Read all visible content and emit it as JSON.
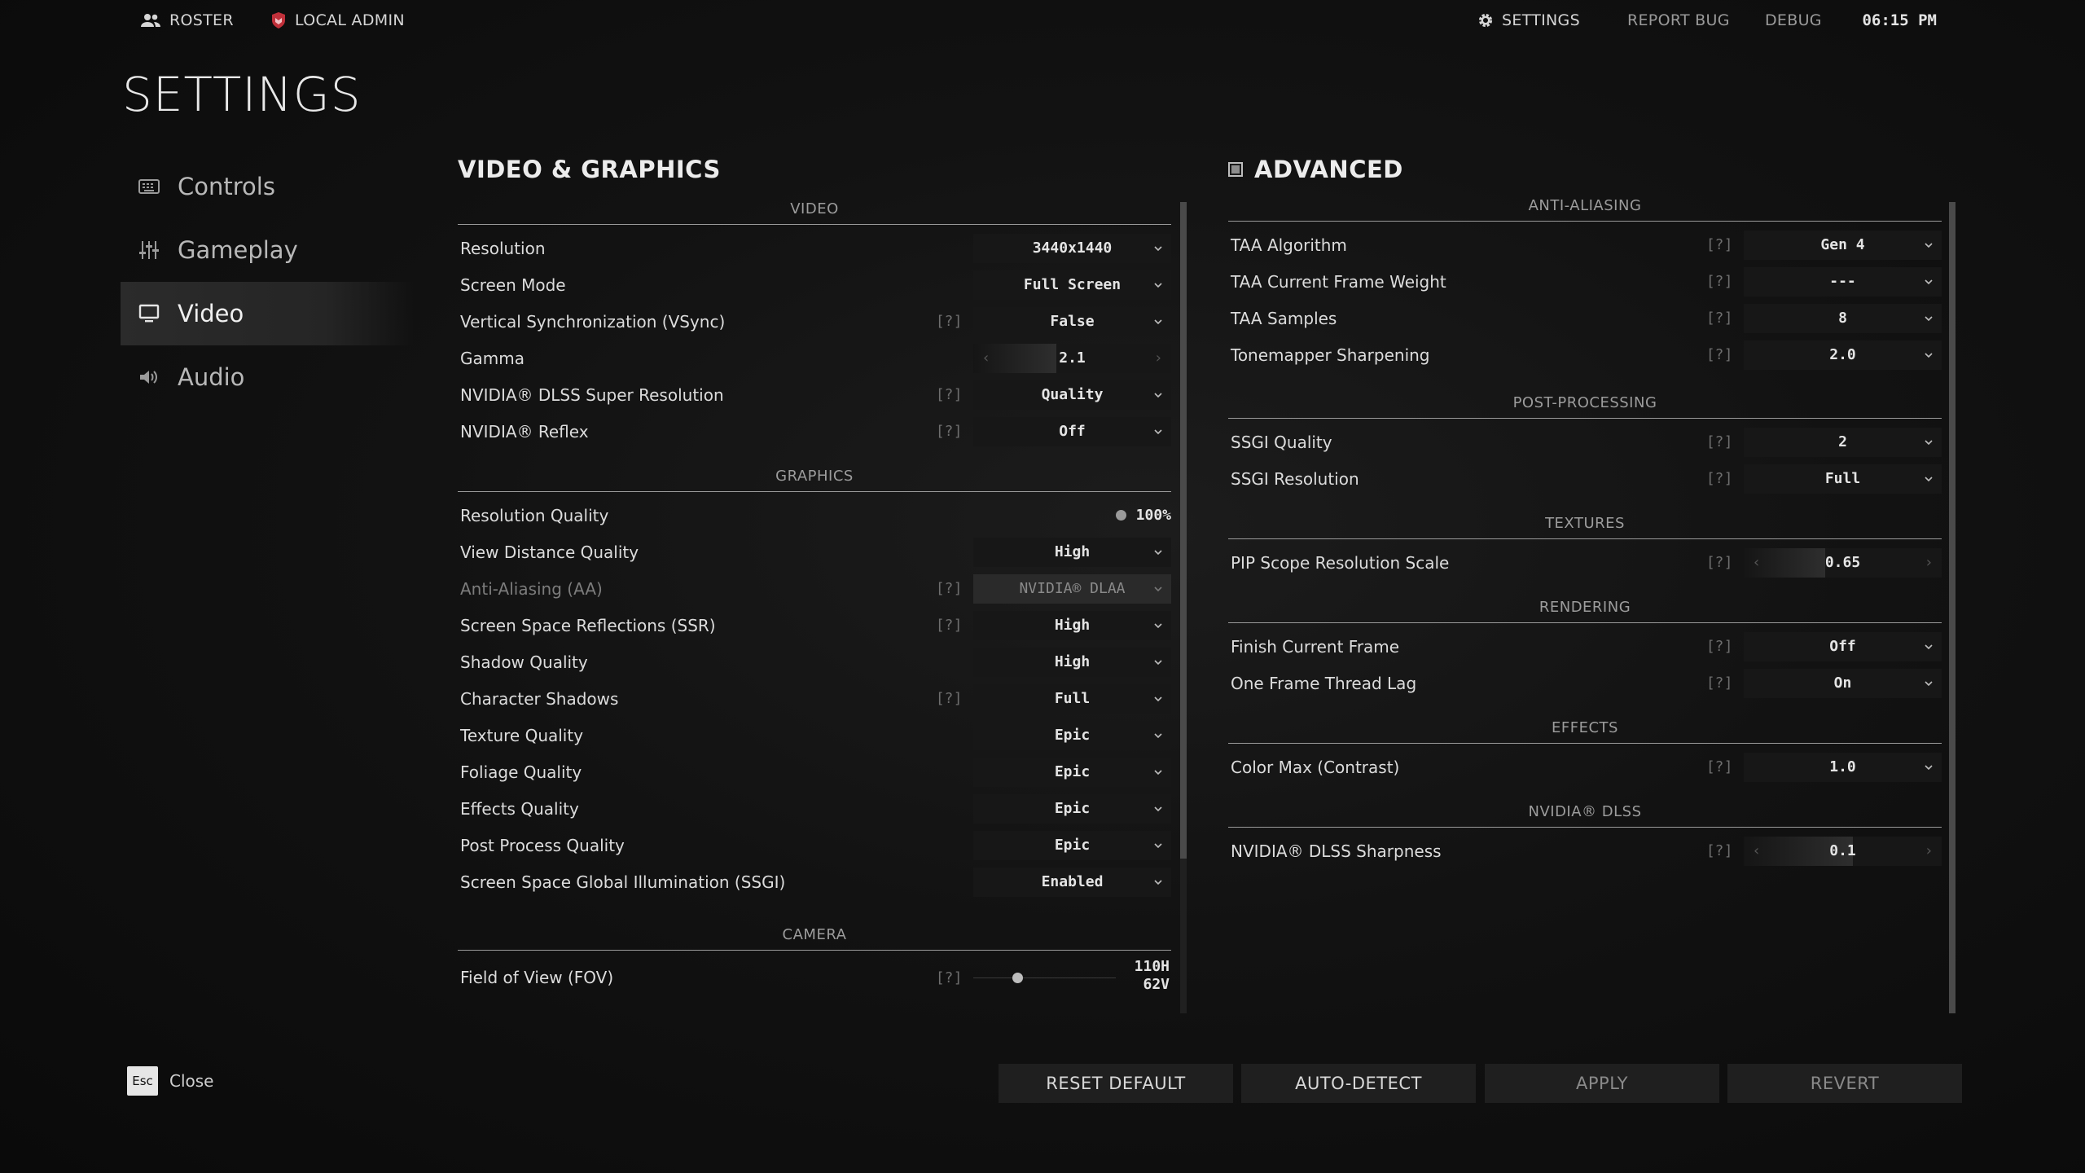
{
  "topbar": {
    "roster": "ROSTER",
    "local_admin": "LOCAL ADMIN",
    "settings": "SETTINGS",
    "report_bug": "REPORT BUG",
    "debug": "DEBUG",
    "time": "06:15 PM"
  },
  "page_title": "SETTINGS",
  "sidebar": {
    "items": [
      {
        "label": "Controls",
        "icon": "keyboard-icon",
        "active": false
      },
      {
        "label": "Gameplay",
        "icon": "sliders-icon",
        "active": false
      },
      {
        "label": "Video",
        "icon": "monitor-icon",
        "active": true
      },
      {
        "label": "Audio",
        "icon": "speaker-icon",
        "active": false
      }
    ]
  },
  "video_panel": {
    "title": "VIDEO & GRAPHICS",
    "help": "[?]",
    "sections": {
      "video": {
        "header": "VIDEO",
        "rows": [
          {
            "label": "Resolution",
            "value": "3440x1440"
          },
          {
            "label": "Screen Mode",
            "value": "Full Screen"
          },
          {
            "label": "Vertical Synchronization (VSync)",
            "value": "False"
          },
          {
            "label": "Gamma",
            "value": "2.1",
            "fill": 0.42
          },
          {
            "label": "NVIDIA® DLSS Super Resolution",
            "value": "Quality"
          },
          {
            "label": "NVIDIA® Reflex",
            "value": "Off"
          }
        ]
      },
      "graphics": {
        "header": "GRAPHICS",
        "rows": [
          {
            "label": "Resolution Quality",
            "value": "100%"
          },
          {
            "label": "View Distance Quality",
            "value": "High"
          },
          {
            "label": "Anti-Aliasing (AA)",
            "value": "NVIDIA® DLAA"
          },
          {
            "label": "Screen Space Reflections (SSR)",
            "value": "High"
          },
          {
            "label": "Shadow Quality",
            "value": "High"
          },
          {
            "label": "Character Shadows",
            "value": "Full"
          },
          {
            "label": "Texture Quality",
            "value": "Epic"
          },
          {
            "label": "Foliage Quality",
            "value": "Epic"
          },
          {
            "label": "Effects Quality",
            "value": "Epic"
          },
          {
            "label": "Post Process Quality",
            "value": "Epic"
          },
          {
            "label": "Screen Space Global Illumination (SSGI)",
            "value": "Enabled"
          }
        ]
      },
      "camera": {
        "header": "CAMERA",
        "rows": [
          {
            "label": "Field of View (FOV)",
            "value_h": "110H",
            "value_v": "62V",
            "fill": 0.31
          }
        ]
      }
    }
  },
  "advanced_panel": {
    "title": "ADVANCED",
    "help": "[?]",
    "sections": {
      "aa": {
        "header": "ANTI-ALIASING",
        "rows": [
          {
            "label": "TAA Algorithm",
            "value": "Gen 4"
          },
          {
            "label": "TAA Current Frame Weight",
            "value": "---"
          },
          {
            "label": "TAA Samples",
            "value": "8"
          },
          {
            "label": "Tonemapper Sharpening",
            "value": "2.0"
          }
        ]
      },
      "post": {
        "header": "POST-PROCESSING",
        "rows": [
          {
            "label": "SSGI Quality",
            "value": "2"
          },
          {
            "label": "SSGI Resolution",
            "value": "Full"
          }
        ]
      },
      "textures": {
        "header": "TEXTURES",
        "rows": [
          {
            "label": "PIP Scope Resolution Scale",
            "value": "0.65",
            "fill": 0.41
          }
        ]
      },
      "rendering": {
        "header": "RENDERING",
        "rows": [
          {
            "label": "Finish Current Frame",
            "value": "Off"
          },
          {
            "label": "One Frame Thread Lag",
            "value": "On"
          }
        ]
      },
      "effects": {
        "header": "EFFECTS",
        "rows": [
          {
            "label": "Color Max (Contrast)",
            "value": "1.0"
          }
        ]
      },
      "dlss": {
        "header": "NVIDIA® DLSS",
        "rows": [
          {
            "label": "NVIDIA® DLSS Sharpness",
            "value": "0.1",
            "fill": 0.55
          }
        ]
      }
    }
  },
  "footer": {
    "esc_key": "Esc",
    "close": "Close",
    "reset_default": "RESET DEFAULT",
    "auto_detect": "AUTO-DETECT",
    "apply": "APPLY",
    "revert": "REVERT"
  }
}
